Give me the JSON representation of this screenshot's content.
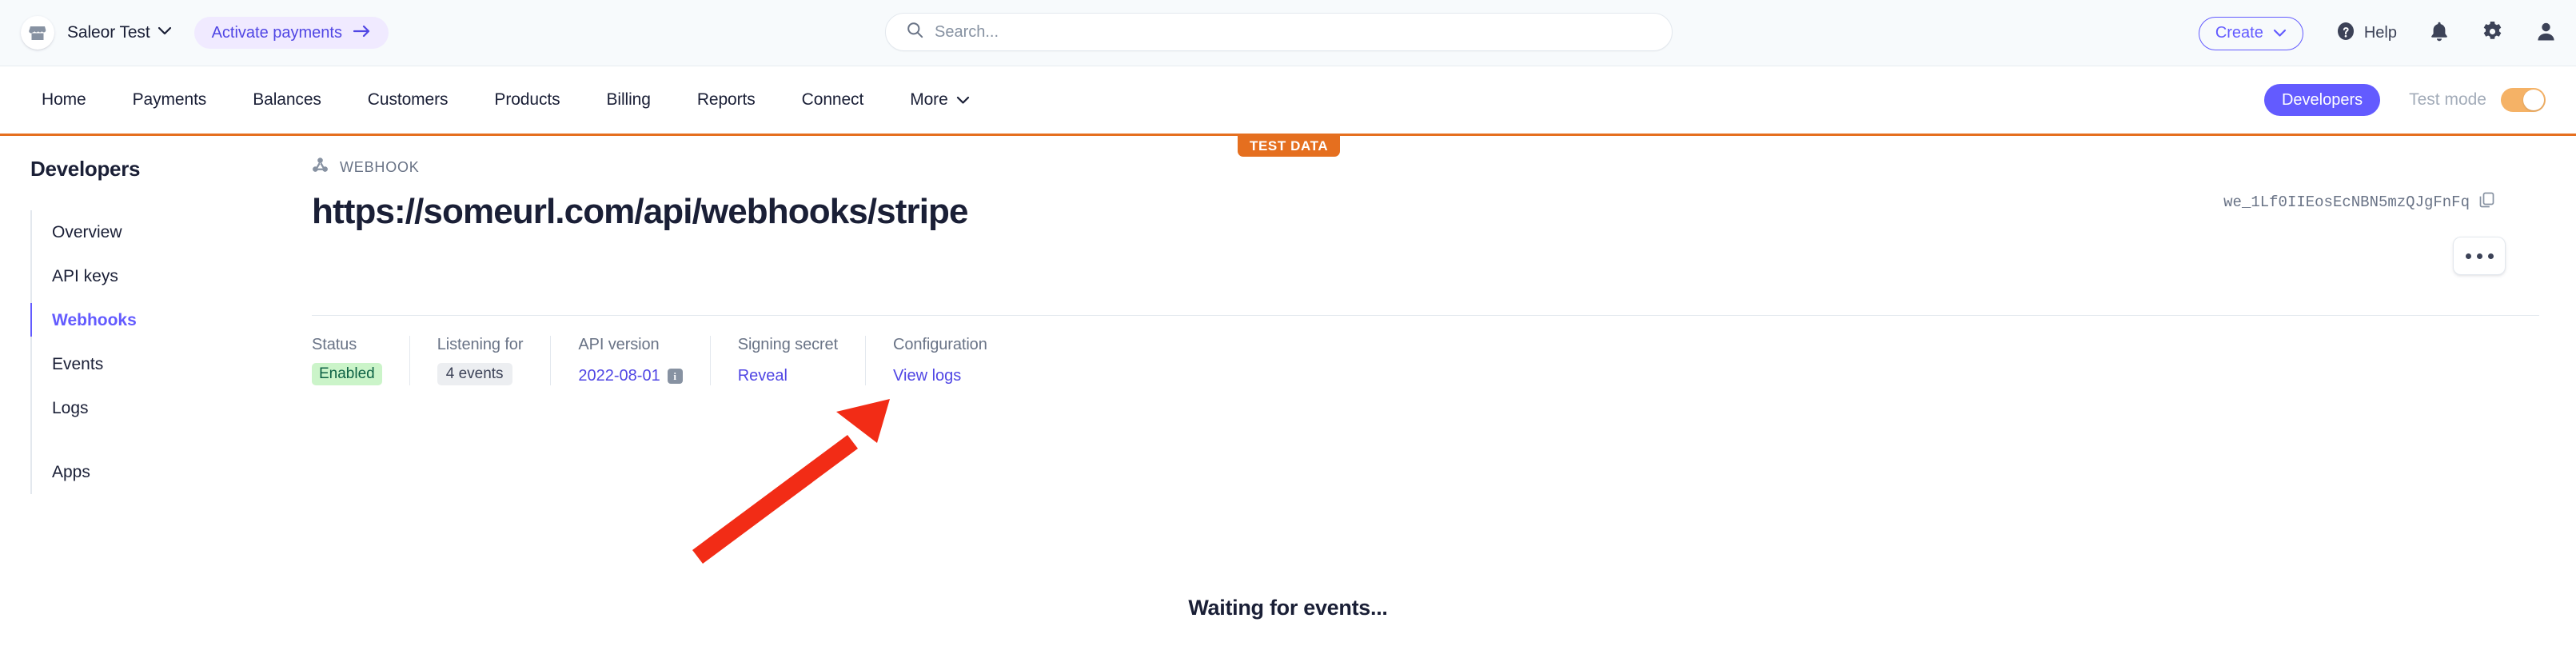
{
  "topbar": {
    "store_logo_icon": "store-icon",
    "store_name": "Saleor Test",
    "store_chevron_icon": "chevron-down-icon",
    "activate_label": "Activate payments",
    "activate_arrow_icon": "arrow-right-icon",
    "search_icon": "search-icon",
    "search_placeholder": "Search...",
    "search_value": "",
    "create_label": "Create",
    "create_chevron_icon": "chevron-down-icon",
    "help_icon": "question-circle-icon",
    "help_label": "Help",
    "notifications_icon": "bell-icon",
    "settings_icon": "gear-icon",
    "account_icon": "user-icon"
  },
  "nav": {
    "items": [
      {
        "label": "Home",
        "has_chevron": false
      },
      {
        "label": "Payments",
        "has_chevron": false
      },
      {
        "label": "Balances",
        "has_chevron": false
      },
      {
        "label": "Customers",
        "has_chevron": false
      },
      {
        "label": "Products",
        "has_chevron": false
      },
      {
        "label": "Billing",
        "has_chevron": false
      },
      {
        "label": "Reports",
        "has_chevron": false
      },
      {
        "label": "Connect",
        "has_chevron": false
      },
      {
        "label": "More",
        "has_chevron": true
      }
    ],
    "developers_label": "Developers",
    "test_mode_label": "Test mode",
    "test_mode_on": true,
    "test_data_badge": "TEST DATA",
    "accent_orange": "#e56f1f",
    "accent_purple": "#635bff"
  },
  "sidebar": {
    "title": "Developers",
    "items": [
      {
        "label": "Overview",
        "active": false
      },
      {
        "label": "API keys",
        "active": false
      },
      {
        "label": "Webhooks",
        "active": true
      },
      {
        "label": "Events",
        "active": false
      },
      {
        "label": "Logs",
        "active": false
      }
    ],
    "items_secondary": [
      {
        "label": "Apps",
        "active": false
      }
    ]
  },
  "main": {
    "kicker_icon": "webhook-icon",
    "kicker": "WEBHOOK",
    "title": "https://someurl.com/api/webhooks/stripe",
    "webhook_id": "we_1Lf0IIEosEcNBN5mzQJgFnFq",
    "copy_icon": "copy-icon",
    "more_button_icon": "ellipsis-icon",
    "stats": [
      {
        "label": "Status",
        "value": "Enabled",
        "style": "badge-green"
      },
      {
        "label": "Listening for",
        "value": "4 events",
        "style": "badge-grey"
      },
      {
        "label": "API version",
        "value": "2022-08-01",
        "style": "link-blue",
        "info_icon": "info-icon"
      },
      {
        "label": "Signing secret",
        "value": "Reveal",
        "style": "link-blue"
      },
      {
        "label": "Configuration",
        "value": "View logs",
        "style": "link-blue"
      }
    ],
    "empty_state": "Waiting for events..."
  },
  "annotation": {
    "arrow_color": "#f22c16",
    "points_to": "Reveal"
  }
}
